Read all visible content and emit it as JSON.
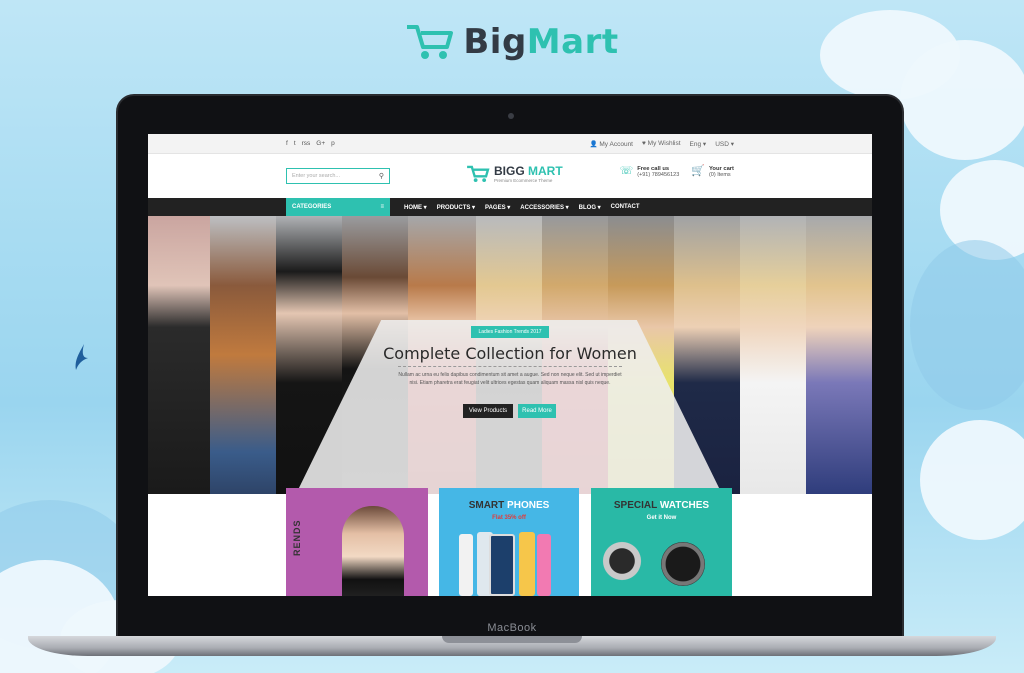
{
  "brand": {
    "name_part1": "Big",
    "name_part2": "Mart"
  },
  "device": {
    "label": "MacBook"
  },
  "site": {
    "topbar": {
      "social": [
        "f",
        "t",
        "rss",
        "G+",
        "p"
      ],
      "account": "My Account",
      "wishlist": "My Wishlist",
      "language": "Eng",
      "currency": "USD"
    },
    "header": {
      "search_placeholder": "Enter your search...",
      "logo_part1": "BIGG",
      "logo_part2": "MART",
      "logo_subtitle": "Premium Ecommerce Theme",
      "call_title": "Free call us",
      "call_number": "(+91) 789456123",
      "cart_title": "Your cart",
      "cart_items": "(0) Items"
    },
    "nav": {
      "categories_label": "CATEGORIES",
      "items": [
        "HOME ▾",
        "PRODUCTS ▾",
        "PAGES ▾",
        "ACCESSORIES ▾",
        "BLOG ▾",
        "CONTACT"
      ]
    },
    "hero": {
      "badge": "Ladies Fashion Trends 2017",
      "title": "Complete Collection for Women",
      "description": "Nullam ac urna eu felis dapibus condimentum sit amet a augue. Sed non neque elit. Sed ut imperdiet nisi. Etiam pharetra erat feugiat velit ultrices egestas quam aliquam massa nisl quis neque.",
      "primary_button": "View Products",
      "secondary_button": "Read More"
    },
    "banners": [
      {
        "label": "RENDS"
      },
      {
        "title_a": "SMART",
        "title_b": "PHONES",
        "subtitle": "Flat 35% off"
      },
      {
        "title_a": "SPECIAL",
        "title_b": "WATCHES",
        "subtitle": "Get it Now"
      }
    ]
  },
  "colors": {
    "accent": "#2ec1b0",
    "dark": "#222222",
    "pink": "#b35aac",
    "blue": "#45b7e6"
  }
}
